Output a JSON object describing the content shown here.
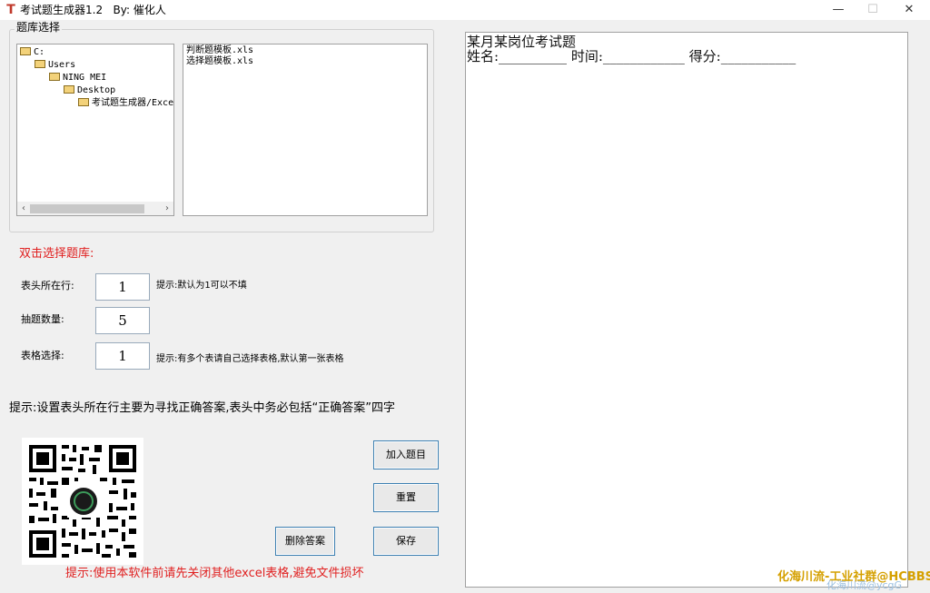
{
  "window": {
    "title": "考试题生成器1.2",
    "author": "By: 催化人",
    "icon": "app-icon",
    "controls": {
      "minimize": "—",
      "maximize": "☐",
      "close": "✕"
    }
  },
  "library": {
    "group_label": "题库选择",
    "tree": [
      "C:",
      "Users",
      "NING MEI",
      "Desktop",
      "考试题生成器/Excel"
    ],
    "files": [
      "判断题模板.xls",
      "选择题模板.xls"
    ],
    "scroll_left": "‹",
    "scroll_right": "›"
  },
  "instructions": {
    "double_click": "双击选择题库:",
    "header_row_label": "表头所在行:",
    "header_row_value": "1",
    "header_row_hint": "提示:默认为1可以不填",
    "count_label": "抽题数量:",
    "count_value": "5",
    "sheet_label": "表格选择:",
    "sheet_value": "1",
    "sheet_hint": "提示:有多个表请自己选择表格,默认第一张表格",
    "main_hint": "提示:设置表头所在行主要为寻找正确答案,表头中务必包括“正确答案”四字",
    "bottom_hint": "提示:使用本软件前请先关闭其他excel表格,避免文件损坏"
  },
  "buttons": {
    "add": "加入题目",
    "reset": "重置",
    "delete_answer": "删除答案",
    "save": "保存"
  },
  "preview": {
    "title": "某月某岗位考试题",
    "info_line": "姓名:__________ 时间:____________ 得分:___________"
  },
  "watermark": {
    "text": "化海川流-工业社群@HCBBS",
    "faded": "化海川流@ycgG"
  },
  "colors": {
    "hint_red": "#e02020",
    "watermark": "#d5a000",
    "button_border": "#3c7fb1"
  }
}
